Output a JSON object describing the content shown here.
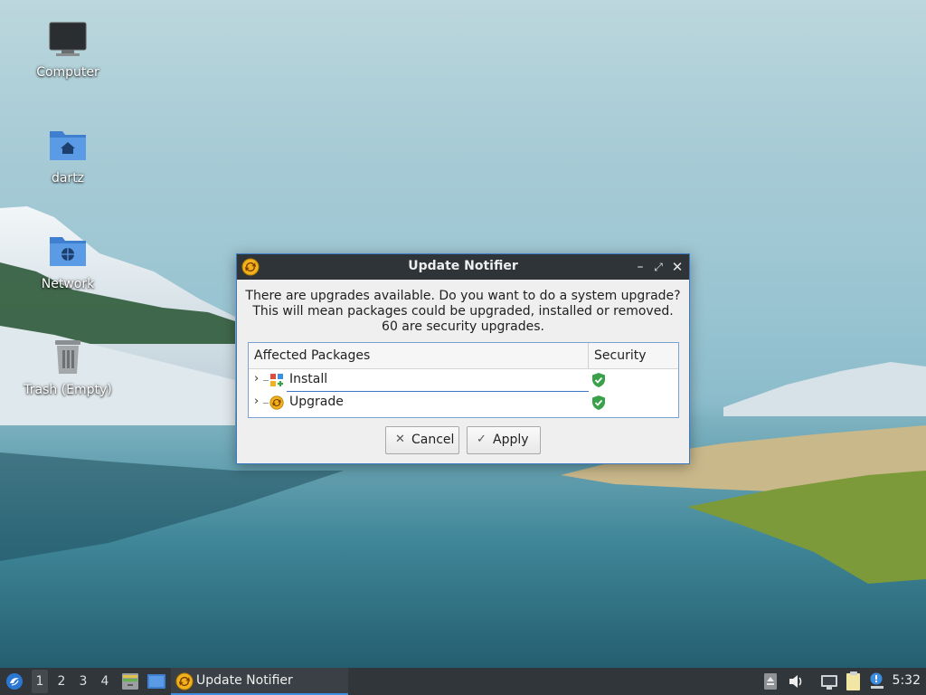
{
  "desktop": {
    "icons": [
      {
        "label": "Computer"
      },
      {
        "label": "dartz"
      },
      {
        "label": "Network"
      },
      {
        "label": "Trash (Empty)"
      }
    ]
  },
  "dialog": {
    "title": "Update Notifier",
    "message_lines": [
      "There are upgrades available. Do you want to do a system upgrade?",
      "This will mean packages could be upgraded, installed or removed.",
      "60 are security upgrades."
    ],
    "table": {
      "columns": [
        "Affected Packages",
        "Security"
      ],
      "rows": [
        {
          "label": "Install",
          "icon": "install-icon",
          "security": "shield-check-icon"
        },
        {
          "label": "Upgrade",
          "icon": "upgrade-icon",
          "security": "shield-check-icon"
        }
      ]
    },
    "buttons": {
      "cancel": "Cancel",
      "apply": "Apply"
    }
  },
  "taskbar": {
    "workspaces": [
      "1",
      "2",
      "3",
      "4"
    ],
    "active_workspace": "1",
    "task": "Update Notifier",
    "clock": "5:32"
  },
  "colors": {
    "accent": "#3d8ee0",
    "titlebar": "#2f3438",
    "taskbar": "#31363b",
    "shield": "#3aa14a"
  }
}
